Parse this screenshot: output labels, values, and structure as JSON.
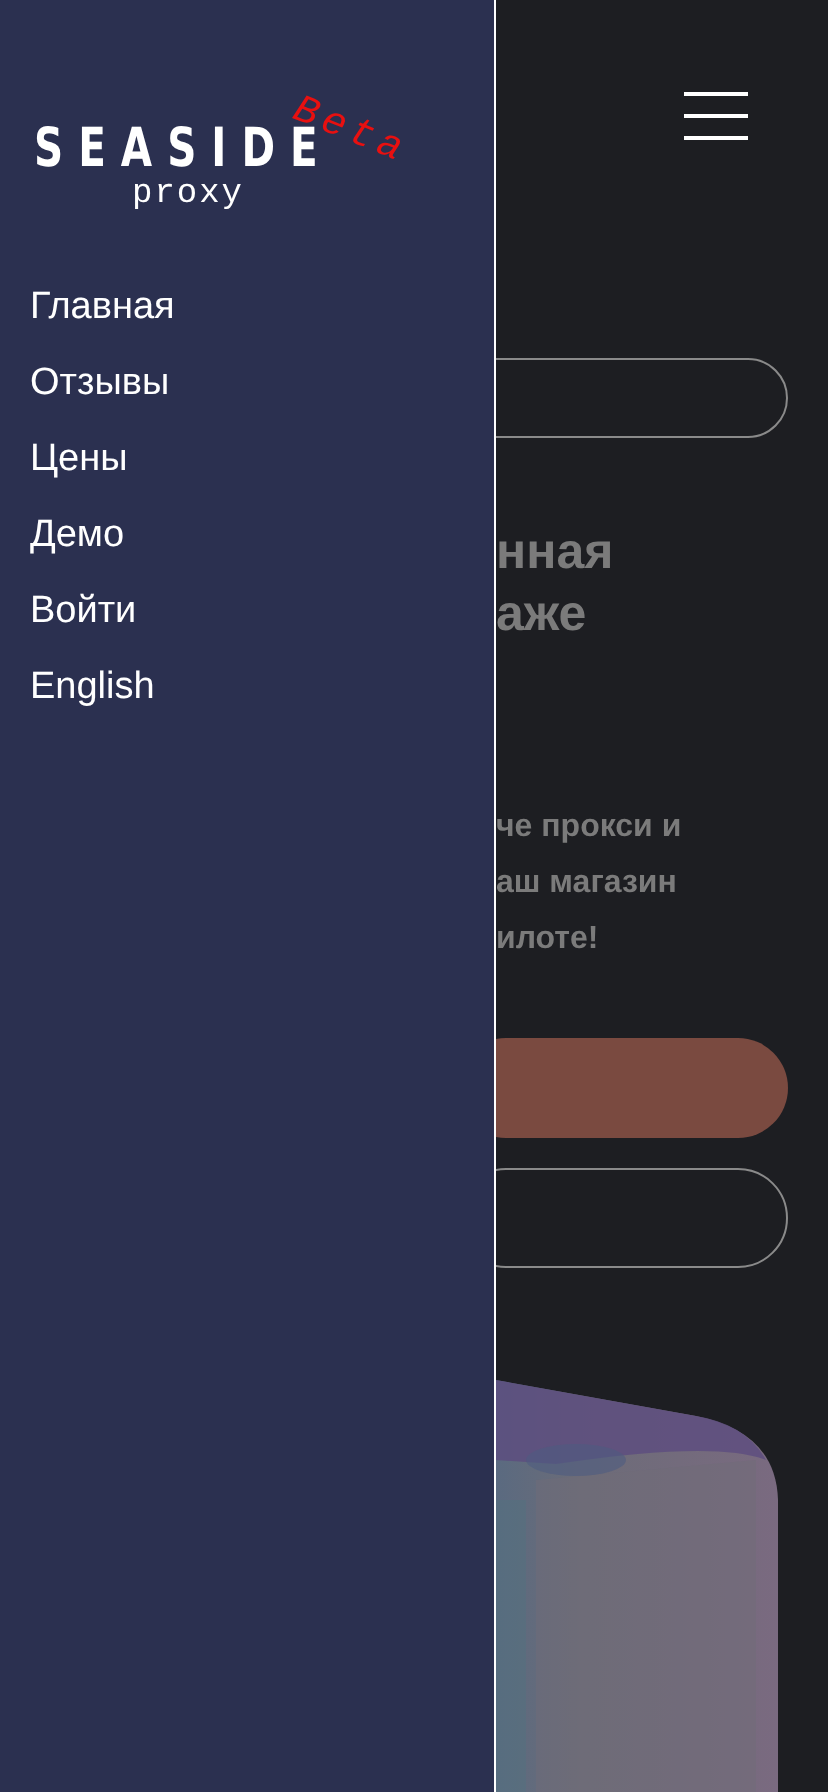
{
  "drawer": {
    "logo": {
      "name": "SEASIDE",
      "sub": "proxy",
      "badge": "Beta"
    },
    "items": [
      {
        "label": "Главная"
      },
      {
        "label": "Отзывы"
      },
      {
        "label": "Цены"
      },
      {
        "label": "Демо"
      },
      {
        "label": "Войти"
      },
      {
        "label": "English"
      }
    ]
  },
  "page": {
    "heading_lines": [
      "нная",
      "аже"
    ],
    "text_lines": [
      "че прокси и",
      "аш магазин",
      "илоте!"
    ],
    "hero": {
      "kind": "picture"
    }
  }
}
